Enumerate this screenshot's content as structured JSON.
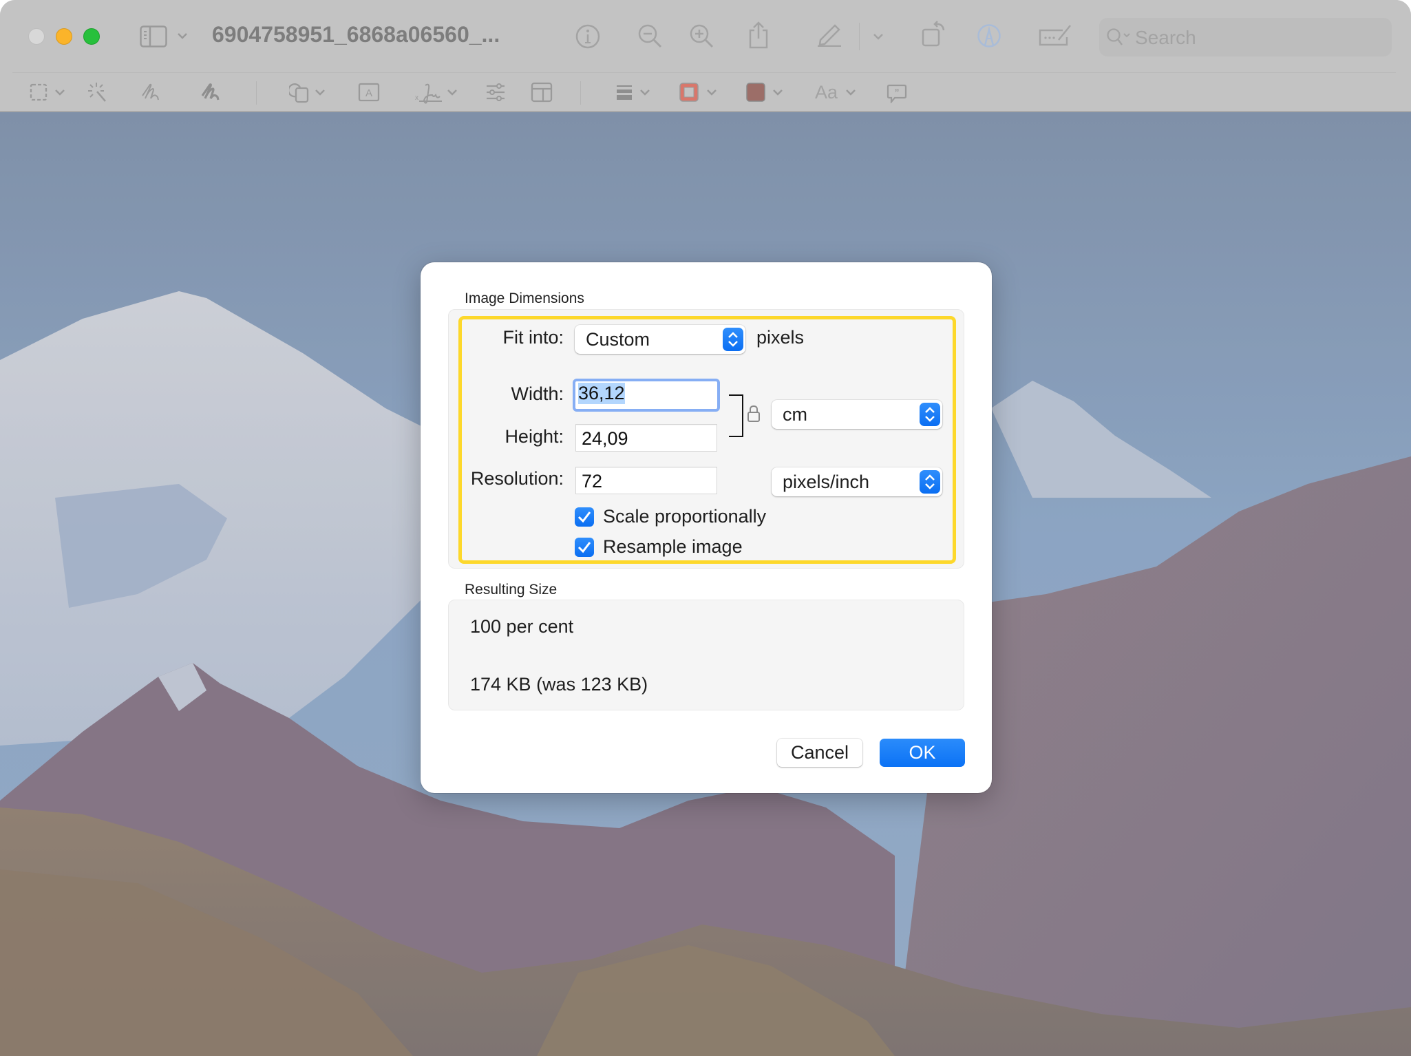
{
  "window": {
    "title": "6904758951_6868a06560_...",
    "traffic_lights": [
      "close",
      "minimize",
      "zoom"
    ]
  },
  "toolbar": {
    "row1": [
      {
        "name": "sidebar-toggle",
        "icon": "sidebar-icon",
        "has_menu": true
      },
      {
        "name": "info",
        "icon": "info-icon"
      },
      {
        "name": "zoom-out",
        "icon": "zoom-out-icon"
      },
      {
        "name": "zoom-in",
        "icon": "zoom-in-icon"
      },
      {
        "name": "share",
        "icon": "share-icon"
      },
      {
        "name": "highlight",
        "icon": "pencil-icon",
        "has_menu": true
      },
      {
        "name": "rotate",
        "icon": "rotate-icon"
      },
      {
        "name": "markup",
        "icon": "markup-icon",
        "active": true
      },
      {
        "name": "form-fill",
        "icon": "form-fill-icon"
      }
    ],
    "search": {
      "placeholder": "Search"
    },
    "row2": [
      {
        "name": "selection",
        "icon": "rect-select-icon",
        "has_menu": true
      },
      {
        "name": "instant-alpha",
        "icon": "magic-wand-icon"
      },
      {
        "name": "sketch",
        "icon": "sketch-icon"
      },
      {
        "name": "draw",
        "icon": "draw-icon"
      },
      {
        "name": "shapes",
        "icon": "shapes-icon",
        "has_menu": true
      },
      {
        "name": "text",
        "icon": "text-box-icon"
      },
      {
        "name": "sign",
        "icon": "signature-icon",
        "has_menu": true
      },
      {
        "name": "adjust-color",
        "icon": "sliders-icon"
      },
      {
        "name": "adjust-size",
        "icon": "layout-icon"
      },
      {
        "name": "shape-style",
        "icon": "line-weight-icon",
        "has_menu": true
      },
      {
        "name": "border-color",
        "icon": "border-color-icon",
        "has_menu": true,
        "color": "#d9776b"
      },
      {
        "name": "fill-color",
        "icon": "fill-color-icon",
        "has_menu": true,
        "color": "#9c6e68"
      },
      {
        "name": "text-style",
        "label": "Aa",
        "has_menu": true
      },
      {
        "name": "annotate",
        "icon": "speech-bubble-icon"
      }
    ]
  },
  "dialog": {
    "image_dimensions_label": "Image Dimensions",
    "fit_into": {
      "label": "Fit into:",
      "value": "Custom",
      "suffix": "pixels"
    },
    "width": {
      "label": "Width:",
      "value": "36,12",
      "focused": true,
      "selected": true
    },
    "height": {
      "label": "Height:",
      "value": "24,09"
    },
    "size_unit": {
      "value": "cm"
    },
    "lock": {
      "icon": "lock-icon"
    },
    "resolution": {
      "label": "Resolution:",
      "value": "72",
      "unit": "pixels/inch"
    },
    "scale_proportionally": {
      "label": "Scale proportionally",
      "checked": true
    },
    "resample_image": {
      "label": "Resample image",
      "checked": true
    },
    "resulting_size_label": "Resulting Size",
    "resulting_percent": "100 per cent",
    "resulting_filesize": "174 KB (was 123 KB)",
    "cancel_label": "Cancel",
    "ok_label": "OK",
    "highlight_color": "#fdd82b",
    "accent_color": "#0a72f5"
  }
}
